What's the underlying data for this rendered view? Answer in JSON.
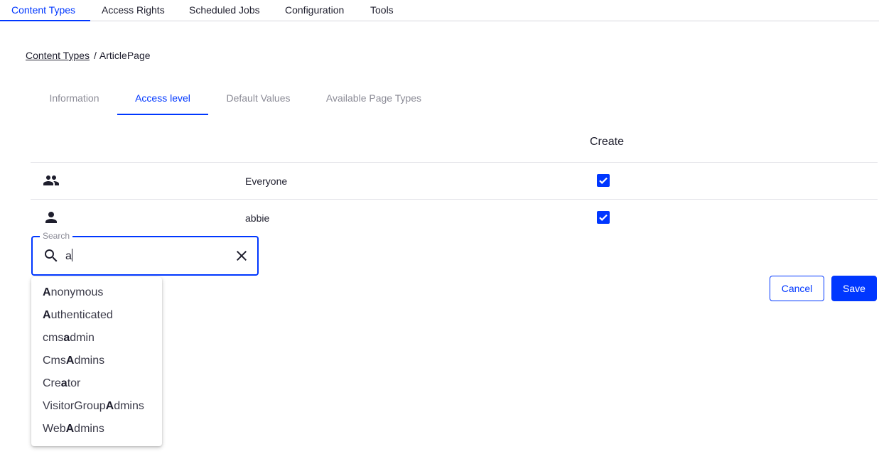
{
  "topnav": {
    "items": [
      {
        "label": "Content Types",
        "active": true
      },
      {
        "label": "Access Rights"
      },
      {
        "label": "Scheduled Jobs"
      },
      {
        "label": "Configuration"
      },
      {
        "label": "Tools"
      }
    ]
  },
  "breadcrumb": {
    "link": "Content Types",
    "separator": "/",
    "current": "ArticlePage"
  },
  "subtabs": [
    {
      "label": "Information"
    },
    {
      "label": "Access level",
      "active": true
    },
    {
      "label": "Default Values"
    },
    {
      "label": "Available Page Types"
    }
  ],
  "table": {
    "column_header": "Create",
    "rows": [
      {
        "icon": "group-icon",
        "name": "Everyone",
        "create": true
      },
      {
        "icon": "person-icon",
        "name": "abbie",
        "create": true
      }
    ]
  },
  "search": {
    "label": "Search",
    "value": "a"
  },
  "suggestions": [
    {
      "pre": "",
      "match": "A",
      "post": "nonymous"
    },
    {
      "pre": "",
      "match": "A",
      "post": "uthenticated"
    },
    {
      "pre": "cms",
      "match": "a",
      "post": "dmin"
    },
    {
      "pre": "Cms",
      "match": "A",
      "post": "dmins"
    },
    {
      "pre": "Cre",
      "match": "a",
      "post": "tor"
    },
    {
      "pre": "VisitorGroup",
      "match": "A",
      "post": "dmins"
    },
    {
      "pre": "Web",
      "match": "A",
      "post": "dmins"
    }
  ],
  "actions": {
    "cancel_label": "Cancel",
    "save_label": "Save"
  },
  "colors": {
    "accent": "#0037ff",
    "text": "#1e1e2d",
    "muted": "#8b8b96"
  }
}
